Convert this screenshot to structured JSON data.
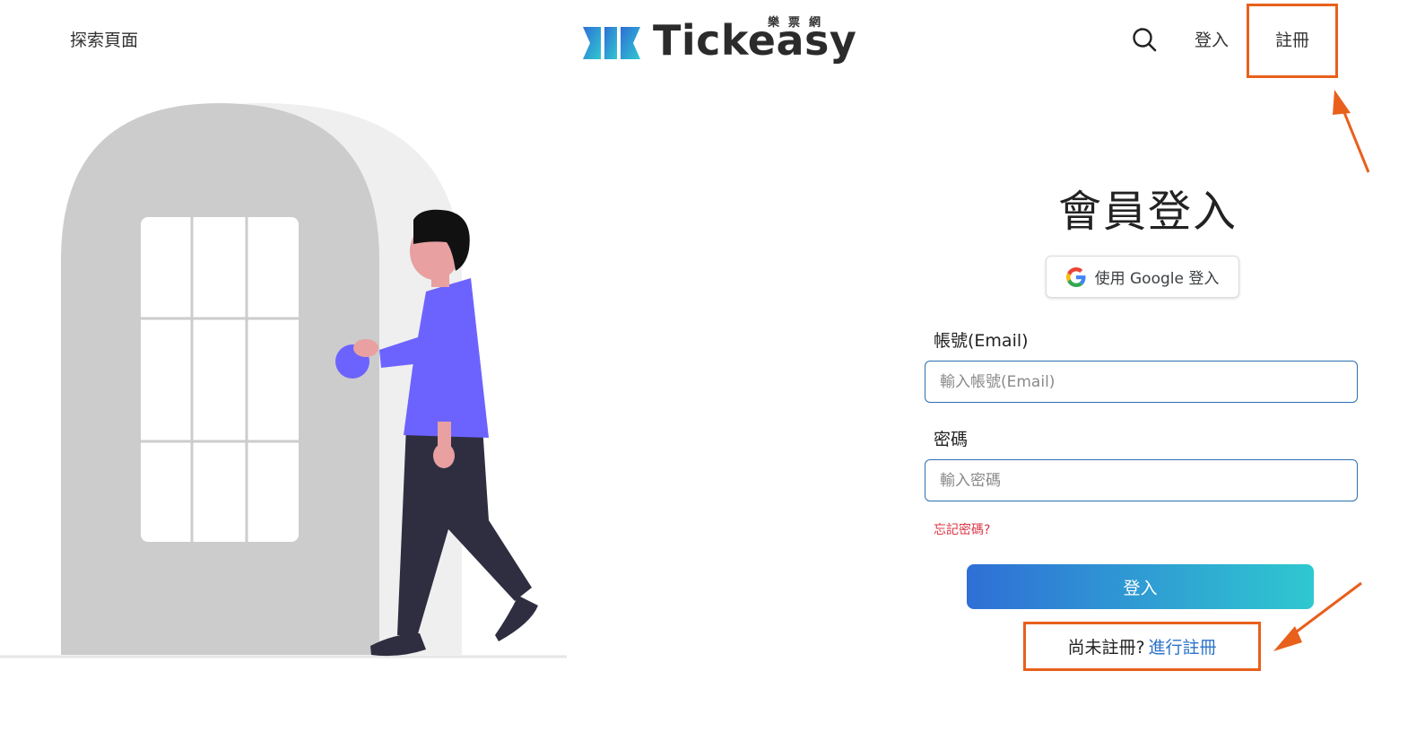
{
  "header": {
    "explore_label": "探索頁面",
    "brand_name": "Tickeasy",
    "brand_sub": "樂票網",
    "login_label": "登入",
    "register_label": "註冊"
  },
  "form": {
    "title": "會員登入",
    "google_button_label": "使用 Google 登入",
    "email_label": "帳號(Email)",
    "email_placeholder": "輸入帳號(Email)",
    "password_label": "密碼",
    "password_placeholder": "輸入密碼",
    "forgot_label": "忘記密碼?",
    "submit_label": "登入",
    "no_account_text": "尚未註冊?",
    "signup_link_label": "進行註冊"
  },
  "colors": {
    "annotation": "#e8601c",
    "link": "#2c73c9",
    "error": "#dc3545",
    "gradient_start": "#2f6fd6",
    "gradient_end": "#2fc8d0"
  },
  "icons": [
    "search-icon",
    "google-icon",
    "brand-logo-icon"
  ]
}
